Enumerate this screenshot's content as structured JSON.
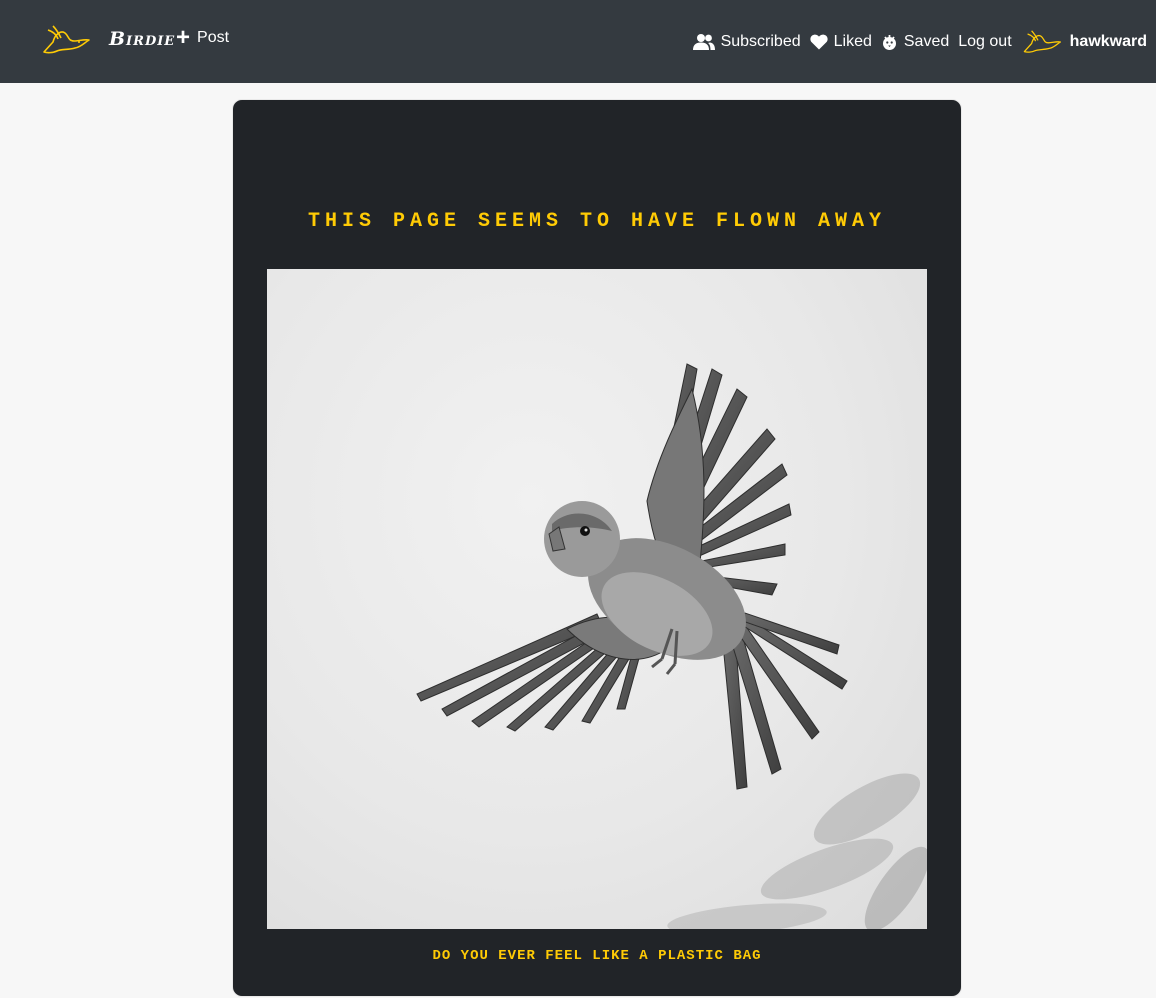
{
  "navbar": {
    "brand": "Birdie",
    "post_label": "Post",
    "links": [
      {
        "label": "Subscribed",
        "icon": "users-icon"
      },
      {
        "label": "Liked",
        "icon": "heart-icon"
      },
      {
        "label": "Saved",
        "icon": "bird-icon"
      },
      {
        "label": "Log out",
        "icon": ""
      }
    ],
    "username": "hawkward"
  },
  "content": {
    "title": "THIS PAGE SEEMS TO HAVE FLOWN AWAY",
    "caption": "DO YOU EVER FEEL LIKE A PLASTIC BAG"
  },
  "colors": {
    "navbar_bg": "#343a40",
    "card_bg": "#212428",
    "accent_yellow": "#ffcb05",
    "page_bg": "#f7f7f7"
  }
}
